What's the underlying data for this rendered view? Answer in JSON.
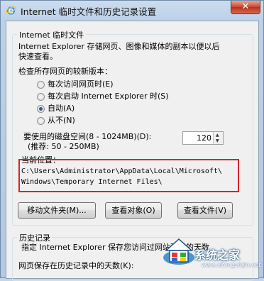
{
  "window": {
    "title": "Internet 临时文件和历史记录设置",
    "close_label": "✕"
  },
  "temp_files": {
    "legend": "Internet 临时文件",
    "description_line1": "Internet Explorer 存储网页、图像和媒体的副本以便以后",
    "description_line2": "快速查看。",
    "check_label": "检查所存网页的较新版本：",
    "options": [
      {
        "label": "每次访问网页时(E)",
        "checked": false
      },
      {
        "label": "每次启动 Internet Explorer 时(S)",
        "checked": false
      },
      {
        "label": "自动(A)",
        "checked": true
      },
      {
        "label": "从不(N)",
        "checked": false
      }
    ],
    "disk_space_label": "要使用的磁盘空间(8 - 1024MB)(D):",
    "disk_space_recommend": "(推荐: 50 - 250MB)",
    "disk_space_value": "120",
    "location_label": "当前位置：",
    "location_path_line1": "C:\\Users\\Administrator\\AppData\\Local\\Microsoft\\",
    "location_path_line2": "Windows\\Temporary Internet Files\\"
  },
  "buttons": {
    "move_folder": "移动文件夹(M)...",
    "view_objects": "查看对象(O)",
    "view_files": "查看文件(V)"
  },
  "history": {
    "legend": "历史记录",
    "description": "指定 Internet Explorer 保存您访问过网站列表的天数",
    "days_label": "网页保存在历史记录中的天数(K):"
  },
  "watermark": {
    "text": "系统之家",
    "url": "www.xitongzhijia.net"
  }
}
